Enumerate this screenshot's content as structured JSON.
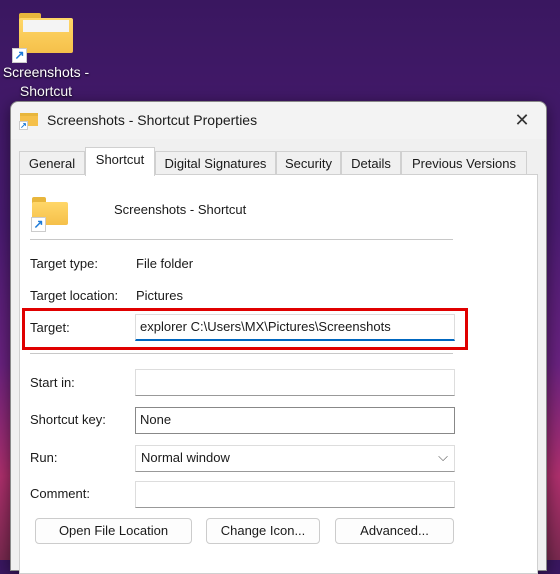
{
  "desktop": {
    "icon_label": "Screenshots - Shortcut"
  },
  "dialog": {
    "title": "Screenshots - Shortcut Properties",
    "tabs": [
      "General",
      "Shortcut",
      "Digital Signatures",
      "Security",
      "Details",
      "Previous Versions"
    ],
    "active_tab": "Shortcut",
    "name": "Screenshots - Shortcut",
    "target_type_label": "Target type:",
    "target_type": "File folder",
    "target_location_label": "Target location:",
    "target_location": "Pictures",
    "target_label": "Target:",
    "target_value": "explorer C:\\Users\\MX\\Pictures\\Screenshots",
    "start_in_label": "Start in:",
    "start_in": "",
    "shortcut_key_label": "Shortcut key:",
    "shortcut_key": "None",
    "run_label": "Run:",
    "run": "Normal window",
    "comment_label": "Comment:",
    "comment": "",
    "buttons": [
      "Open File Location",
      "Change Icon...",
      "Advanced..."
    ],
    "highlight_color": "#e00000",
    "accent": "#0067c0"
  }
}
